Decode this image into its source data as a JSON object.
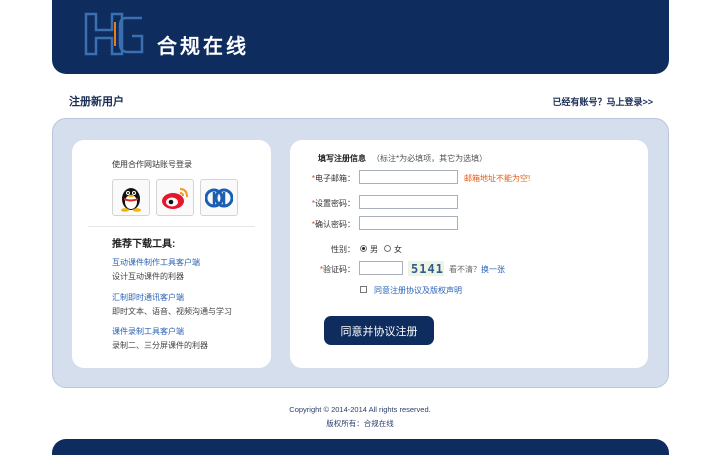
{
  "header": {
    "brand": "合规在线",
    "colors": {
      "header_bg": "#0e2d5e",
      "logo_blue": "#3a6fb0",
      "logo_orange": "#ef7b12"
    }
  },
  "titlebar": {
    "page_title": "注册新用户",
    "login_link": "已经有账号？马上登录>>"
  },
  "left": {
    "partner_label": "使用合作网站账号登录",
    "social_icons": [
      "qq-icon",
      "weibo-icon",
      "renren-icon"
    ],
    "rec_title": "推荐下载工具:",
    "tools": [
      {
        "name": "互动课件制作工具客户端",
        "desc": "设计互动课件的利器"
      },
      {
        "name": "汇制即时通讯客户端",
        "desc": "即时文本、语音、视频沟通与学习"
      },
      {
        "name": "课件录制工具客户端",
        "desc": "录制二、三分屏课件的利器"
      }
    ]
  },
  "form": {
    "title": "填写注册信息",
    "note": "（标注*为必填项，其它为选填）",
    "required_mark": "*",
    "email_label": "电子邮箱：",
    "email_value": "",
    "email_error": "邮箱地址不能为空!",
    "password_label": "设置密码：",
    "confirm_label": "确认密码：",
    "gender_label": "性别：",
    "gender_male": "男",
    "gender_female": "女",
    "captcha_label": "验证码：",
    "captcha_value": "",
    "captcha_text": "5141",
    "captcha_hint": "看不清？",
    "captcha_change": "换一张",
    "agree_text": "同意注册协议及版权声明",
    "submit_label": "同意并协议注册"
  },
  "footer": {
    "copyright": "Copyright © 2014-2014    All rights reserved.",
    "owner": "版权所有：合规在线"
  }
}
